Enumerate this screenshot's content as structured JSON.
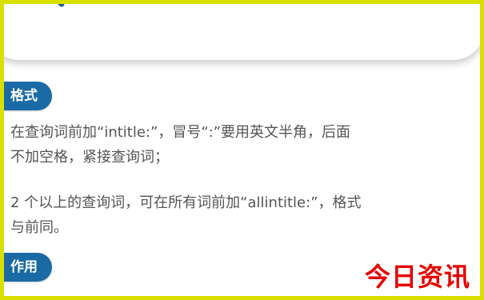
{
  "search": {
    "query_text": "intitle:"
  },
  "sections": [
    {
      "badge": "格式",
      "lines": [
        "在查询词前加“intitle:”，冒号“:”要用英文半角，后面",
        "不加空格，紧接查询词；"
      ]
    },
    {
      "lines": [
        "2 个以上的查询词，可在所有词前加“allintitle:”，格式",
        "与前同。"
      ]
    },
    {
      "badge": "作用"
    }
  ],
  "watermark": "今日资讯",
  "colors": {
    "frame_border": "#d9e000",
    "badge_background": "#1a6aa5",
    "query_text": "#1b5d8f",
    "watermark": "#e60000"
  }
}
